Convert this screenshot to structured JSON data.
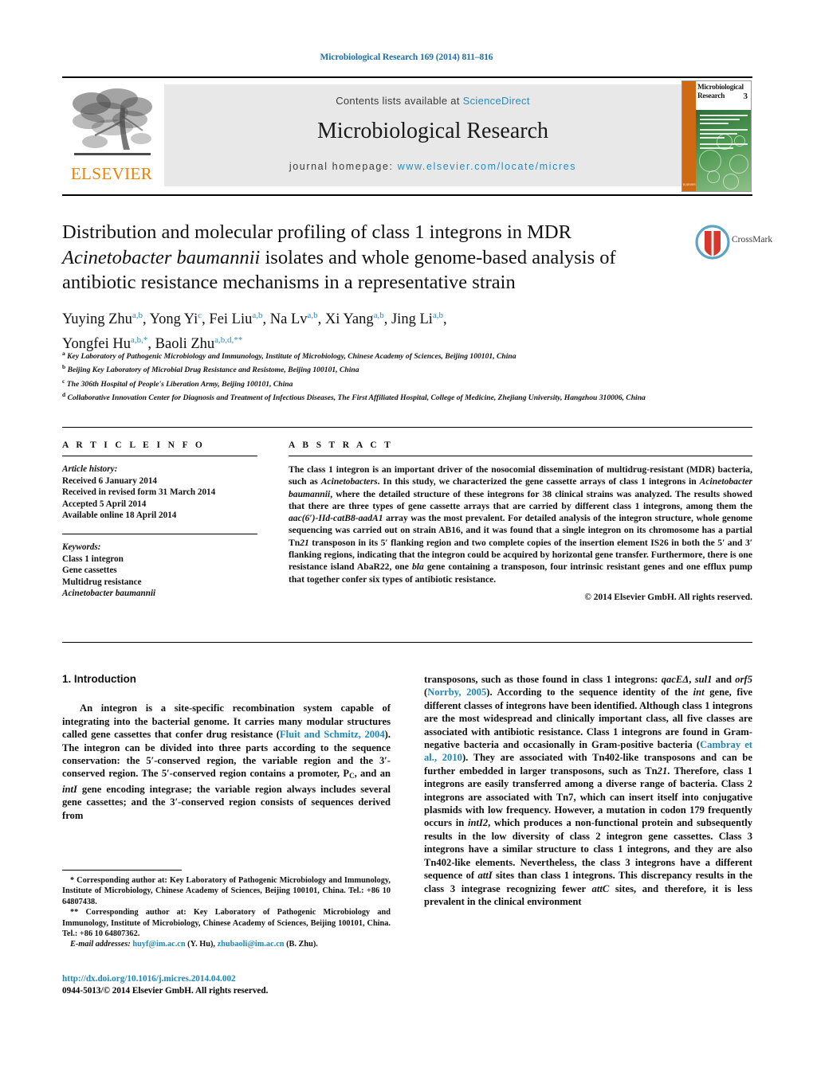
{
  "running_head": "Microbiological Research 169 (2014) 811–816",
  "masthead": {
    "publisher_logo_text": "ELSEVIER",
    "contents_prefix": "Contents lists available at ",
    "contents_link": "ScienceDirect",
    "journal_name": "Microbiological Research",
    "homepage_prefix": "journal homepage: ",
    "homepage_url": "www.elsevier.com/locate/micres",
    "cover": {
      "title_line1": "Microbiological",
      "title_line2": "Research",
      "issue_number": "3",
      "publisher_mark": "ELSEVIER"
    }
  },
  "crossmark": {
    "label": "CrossMark"
  },
  "article": {
    "title_line1": "Distribution and molecular profiling of class 1 integrons in MDR",
    "title_italic": "Acinetobacter baumannii",
    "title_line2_rest": " isolates and whole genome-based analysis of",
    "title_line3": "antibiotic resistance mechanisms in a representative strain",
    "authors": [
      {
        "name": "Yuying Zhu",
        "sup": "a,b"
      },
      {
        "name": "Yong Yi",
        "sup": "c"
      },
      {
        "name": "Fei Liu",
        "sup": "a,b"
      },
      {
        "name": "Na Lv",
        "sup": "a,b"
      },
      {
        "name": "Xi Yang",
        "sup": "a,b"
      },
      {
        "name": "Jing Li",
        "sup": "a,b"
      },
      {
        "name": "Yongfei Hu",
        "sup": "a,b,*"
      },
      {
        "name": "Baoli Zhu",
        "sup": "a,b,d,**"
      }
    ],
    "affiliations": [
      {
        "marker": "a",
        "text": "Key Laboratory of Pathogenic Microbiology and Immunology, Institute of Microbiology, Chinese Academy of Sciences, Beijing 100101, China"
      },
      {
        "marker": "b",
        "text": "Beijing Key Laboratory of Microbial Drug Resistance and Resistome, Beijing 100101, China"
      },
      {
        "marker": "c",
        "text": "The 306th Hospital of People's Liberation Army, Beijing 100101, China"
      },
      {
        "marker": "d",
        "text": "Collaborative Innovation Center for Diagnosis and Treatment of Infectious Diseases, The First Affiliated Hospital, College of Medicine, Zhejiang University, Hangzhou 310006, China"
      }
    ]
  },
  "article_info": {
    "heading": "A R T I C L E   I N F O",
    "history_label": "Article history:",
    "history": [
      "Received 6 January 2014",
      "Received in revised form 31 March 2014",
      "Accepted 5 April 2014",
      "Available online 18 April 2014"
    ],
    "keywords_label": "Keywords:",
    "keywords": [
      "Class 1 integron",
      "Gene cassettes",
      "Multidrug resistance",
      "Acinetobacter baumannii"
    ]
  },
  "abstract": {
    "heading": "A B S T R A C T",
    "p1_a": "The class 1 integron is an important driver of the nosocomial dissemination of multidrug-resistant (MDR) bacteria, such as ",
    "p1_it1": "Acinetobacters",
    "p1_b": ". In this study, we characterized the gene cassette arrays of class 1 integrons in ",
    "p1_it2": "Acinetobacter baumannii",
    "p1_c": ", where the detailed structure of these integrons for 38 clinical strains was analyzed. The results showed that there are three types of gene cassette arrays that are carried by different class 1 integrons, among them the ",
    "p1_it3": "aac(6′)-IId-catB8-aadA1",
    "p1_d": " array was the most prevalent. For detailed analysis of the integron structure, whole genome sequencing was carried out on strain AB16, and it was found that a single integron on its chromosome has a partial Tn",
    "p1_it4": "21",
    "p1_e": " transposon in its 5′ flanking region and two complete copies of the insertion element IS26 in both the 5′ and 3′ flanking regions, indicating that the integron could be acquired by horizontal gene transfer. Furthermore, there is one resistance island AbaR22, one ",
    "p1_it5": "bla",
    "p1_f": " gene containing a transposon, four intrinsic resistant genes and one efflux pump that together confer six types of antibiotic resistance.",
    "copyright": "© 2014 Elsevier GmbH. All rights reserved."
  },
  "body": {
    "section_number_title": "1.  Introduction",
    "left_a": "An integron is a site-specific recombination system capable of integrating into the bacterial genome. It carries many modular structures called gene cassettes that confer drug resistance (",
    "left_ref1": "Fluit and Schmitz, 2004",
    "left_b": "). The integron can be divided into three parts according to the sequence conservation: the 5′-conserved region, the variable region and the 3′-conserved region. The 5′-conserved region contains a promoter, P",
    "left_sub": "C",
    "left_c": ", and an ",
    "left_it1": "intI",
    "left_d": " gene encoding integrase; the variable region always includes several gene cassettes; and the 3′-conserved region consists of sequences derived from",
    "right_a": "transposons, such as those found in class 1 integrons: ",
    "right_it1": "qacEΔ",
    "right_b": ", ",
    "right_it2": "sul1",
    "right_c": " and ",
    "right_it3": "orf5",
    "right_d": " (",
    "right_ref1": "Norrby, 2005",
    "right_e": "). According to the sequence identity of the ",
    "right_it4": "int",
    "right_f": " gene, five different classes of integrons have been identified. Although class 1 integrons are the most widespread and clinically important class, all five classes are associated with antibiotic resistance. Class 1 integrons are found in Gram-negative bacteria and occasionally in Gram-positive bacteria (",
    "right_ref2": "Cambray et al., 2010",
    "right_g": "). They are associated with Tn402-like transposons and can be further embedded in larger transposons, such as Tn",
    "right_it5": "21",
    "right_h": ". Therefore, class 1 integrons are easily transferred among a diverse range of bacteria. Class 2 integrons are associated with Tn7, which can insert itself into conjugative plasmids with low frequency. However, a mutation in codon 179 frequently occurs in ",
    "right_it6": "intI2",
    "right_i": ", which produces a non-functional protein and subsequently results in the low diversity of class 2 integron gene cassettes. Class 3 integrons have a similar structure to class 1 integrons, and they are also Tn402-like elements. Nevertheless, the class 3 integrons have a different sequence of ",
    "right_it7": "attI",
    "right_j": " sites than class 1 integrons. This discrepancy results in the class 3 integrase recognizing fewer ",
    "right_it8": "attC",
    "right_k": " sites, and therefore, it is less prevalent in the clinical environment"
  },
  "footnotes": {
    "corr1": "*  Corresponding author at: Key Laboratory of Pathogenic Microbiology and Immunology, Institute of Microbiology, Chinese Academy of Sciences, Beijing 100101, China. Tel.: +86 10 64807438.",
    "corr2": "**  Corresponding author at: Key Laboratory of Pathogenic Microbiology and Immunology, Institute of Microbiology, Chinese Academy of Sciences, Beijing 100101, China. Tel.: +86 10 64807362.",
    "email_label": "E-mail addresses:",
    "email1": "huyf@im.ac.cn",
    "email1_owner": " (Y. Hu),",
    "email2": "zhubaoli@im.ac.cn",
    "email2_owner": " (B. Zhu)."
  },
  "doi_block": {
    "doi": "http://dx.doi.org/10.1016/j.micres.2014.04.002",
    "issn_line": "0944-5013/© 2014 Elsevier GmbH. All rights reserved."
  },
  "colors": {
    "link_blue": "#1f86b4",
    "header_blue": "#1d6fa5",
    "elsevier_orange": "#f08100",
    "masthead_grey": "#e8e8e8",
    "crossmark_red": "#d6382b",
    "crossmark_blue": "#5ba4c4"
  }
}
